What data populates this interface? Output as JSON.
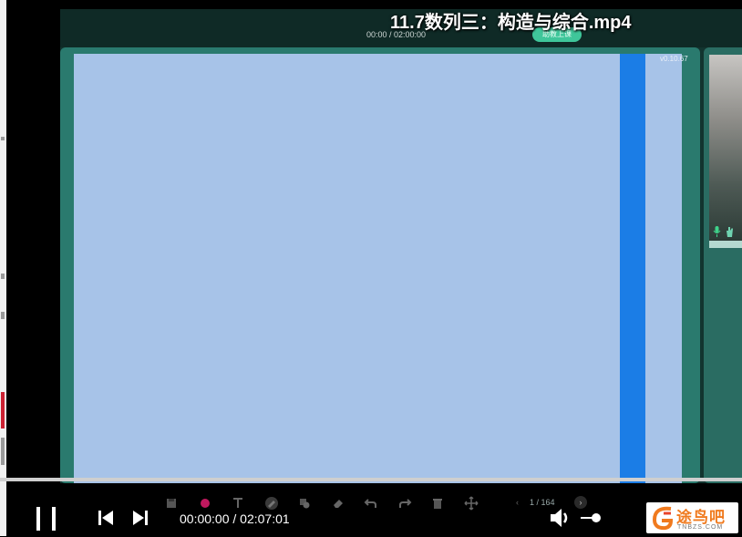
{
  "video": {
    "title": "11.7数列三：构造与综合.mp4",
    "lesson_time": "00:00 / 02:00:00",
    "assist_badge": "助教上课",
    "version": "v0.10.67"
  },
  "board_toolbar": {
    "tools": [
      "save-icon",
      "color-dot-icon",
      "text-icon",
      "pen-icon",
      "shape-icon",
      "eraser-icon",
      "undo-icon",
      "redo-icon",
      "trash-icon",
      "move-icon"
    ],
    "accent_color": "#c0185e",
    "page_indicator": "1 / 164",
    "prev_label": "‹",
    "next_label": "›"
  },
  "player": {
    "time": "00:00:00 / 02:07:01",
    "progress": 0,
    "volume": 0.75
  },
  "watermark": {
    "name": "途鸟吧",
    "url": "TNBZS.COM"
  },
  "colors": {
    "board": "#a7c3e8",
    "board_scroll": "#1b7de6",
    "frame": "#2a7a6e"
  }
}
